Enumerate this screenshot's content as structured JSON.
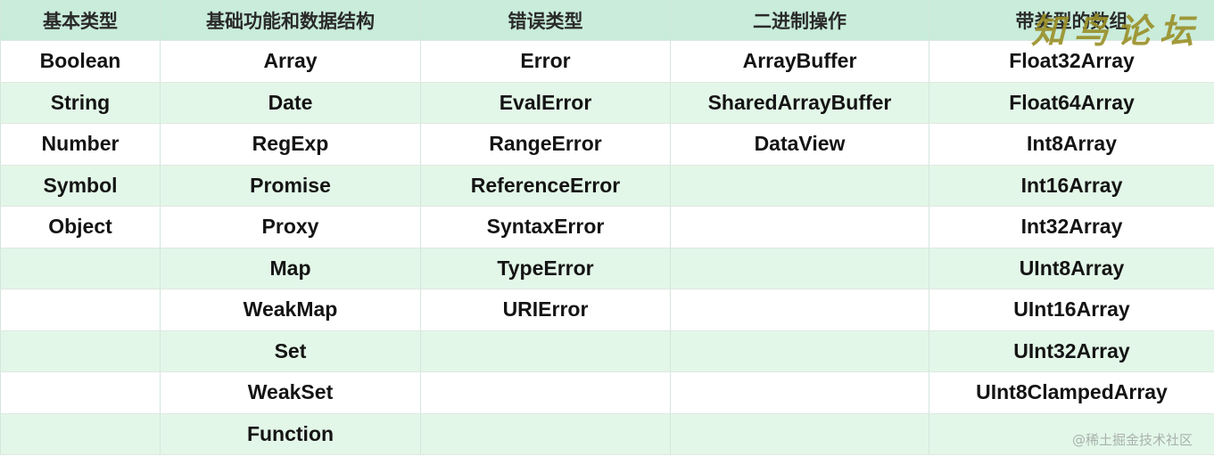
{
  "table": {
    "headers": [
      "基本类型",
      "基础功能和数据结构",
      "错误类型",
      "二进制操作",
      "带类型的数组"
    ],
    "rows": [
      [
        "Boolean",
        "Array",
        "Error",
        "ArrayBuffer",
        "Float32Array"
      ],
      [
        "String",
        "Date",
        "EvalError",
        "SharedArrayBuffer",
        "Float64Array"
      ],
      [
        "Number",
        "RegExp",
        "RangeError",
        "DataView",
        "Int8Array"
      ],
      [
        "Symbol",
        "Promise",
        "ReferenceError",
        "",
        "Int16Array"
      ],
      [
        "Object",
        "Proxy",
        "SyntaxError",
        "",
        "Int32Array"
      ],
      [
        "",
        "Map",
        "TypeError",
        "",
        "UInt8Array"
      ],
      [
        "",
        "WeakMap",
        "URIError",
        "",
        "UInt16Array"
      ],
      [
        "",
        "Set",
        "",
        "",
        "UInt32Array"
      ],
      [
        "",
        "WeakSet",
        "",
        "",
        "UInt8ClampedArray"
      ],
      [
        "",
        "Function",
        "",
        "",
        ""
      ]
    ]
  },
  "watermarks": {
    "top_right": "知鸟论坛",
    "bottom_right": "@稀土掘金技术社区"
  },
  "colors": {
    "header_bg": "#c9ecdb",
    "row_alt_bg": "#e3f7e8",
    "row_bg": "#ffffff"
  }
}
